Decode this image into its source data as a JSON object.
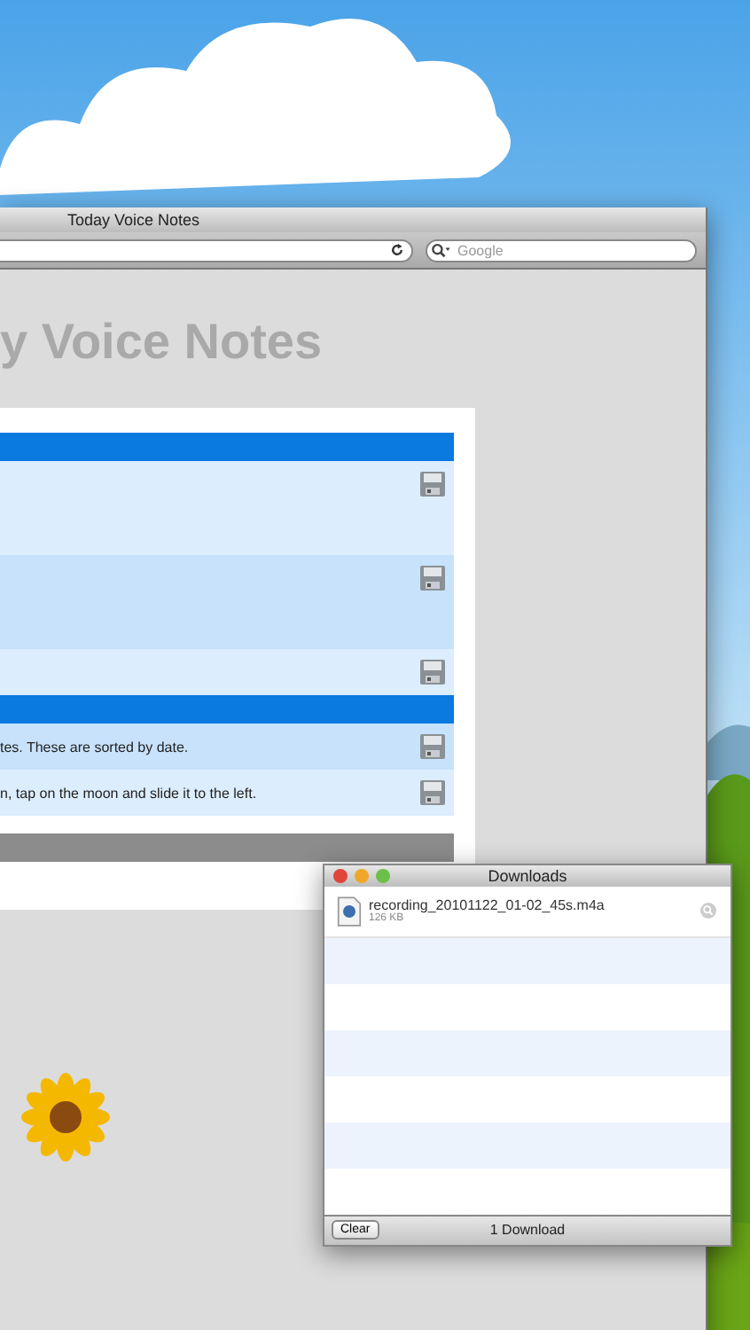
{
  "browser": {
    "title": "Today Voice Notes",
    "search": {
      "placeholder": "Google"
    },
    "heading": "y Voice Notes",
    "sections": [
      {
        "rows": [
          {
            "kind": "tall"
          },
          {
            "kind": "tall"
          },
          {
            "kind": "short"
          }
        ]
      },
      {
        "rows": [
          {
            "kind": "note",
            "text": "tes. These are sorted by date."
          },
          {
            "kind": "note",
            "text": "n, tap on the moon and slide it to the left."
          }
        ]
      }
    ]
  },
  "downloads": {
    "title": "Downloads",
    "items": [
      {
        "filename": "recording_20101122_01-02_45s.m4a",
        "size": "126 KB"
      }
    ],
    "clear_button": "Clear",
    "status": "1 Download"
  }
}
